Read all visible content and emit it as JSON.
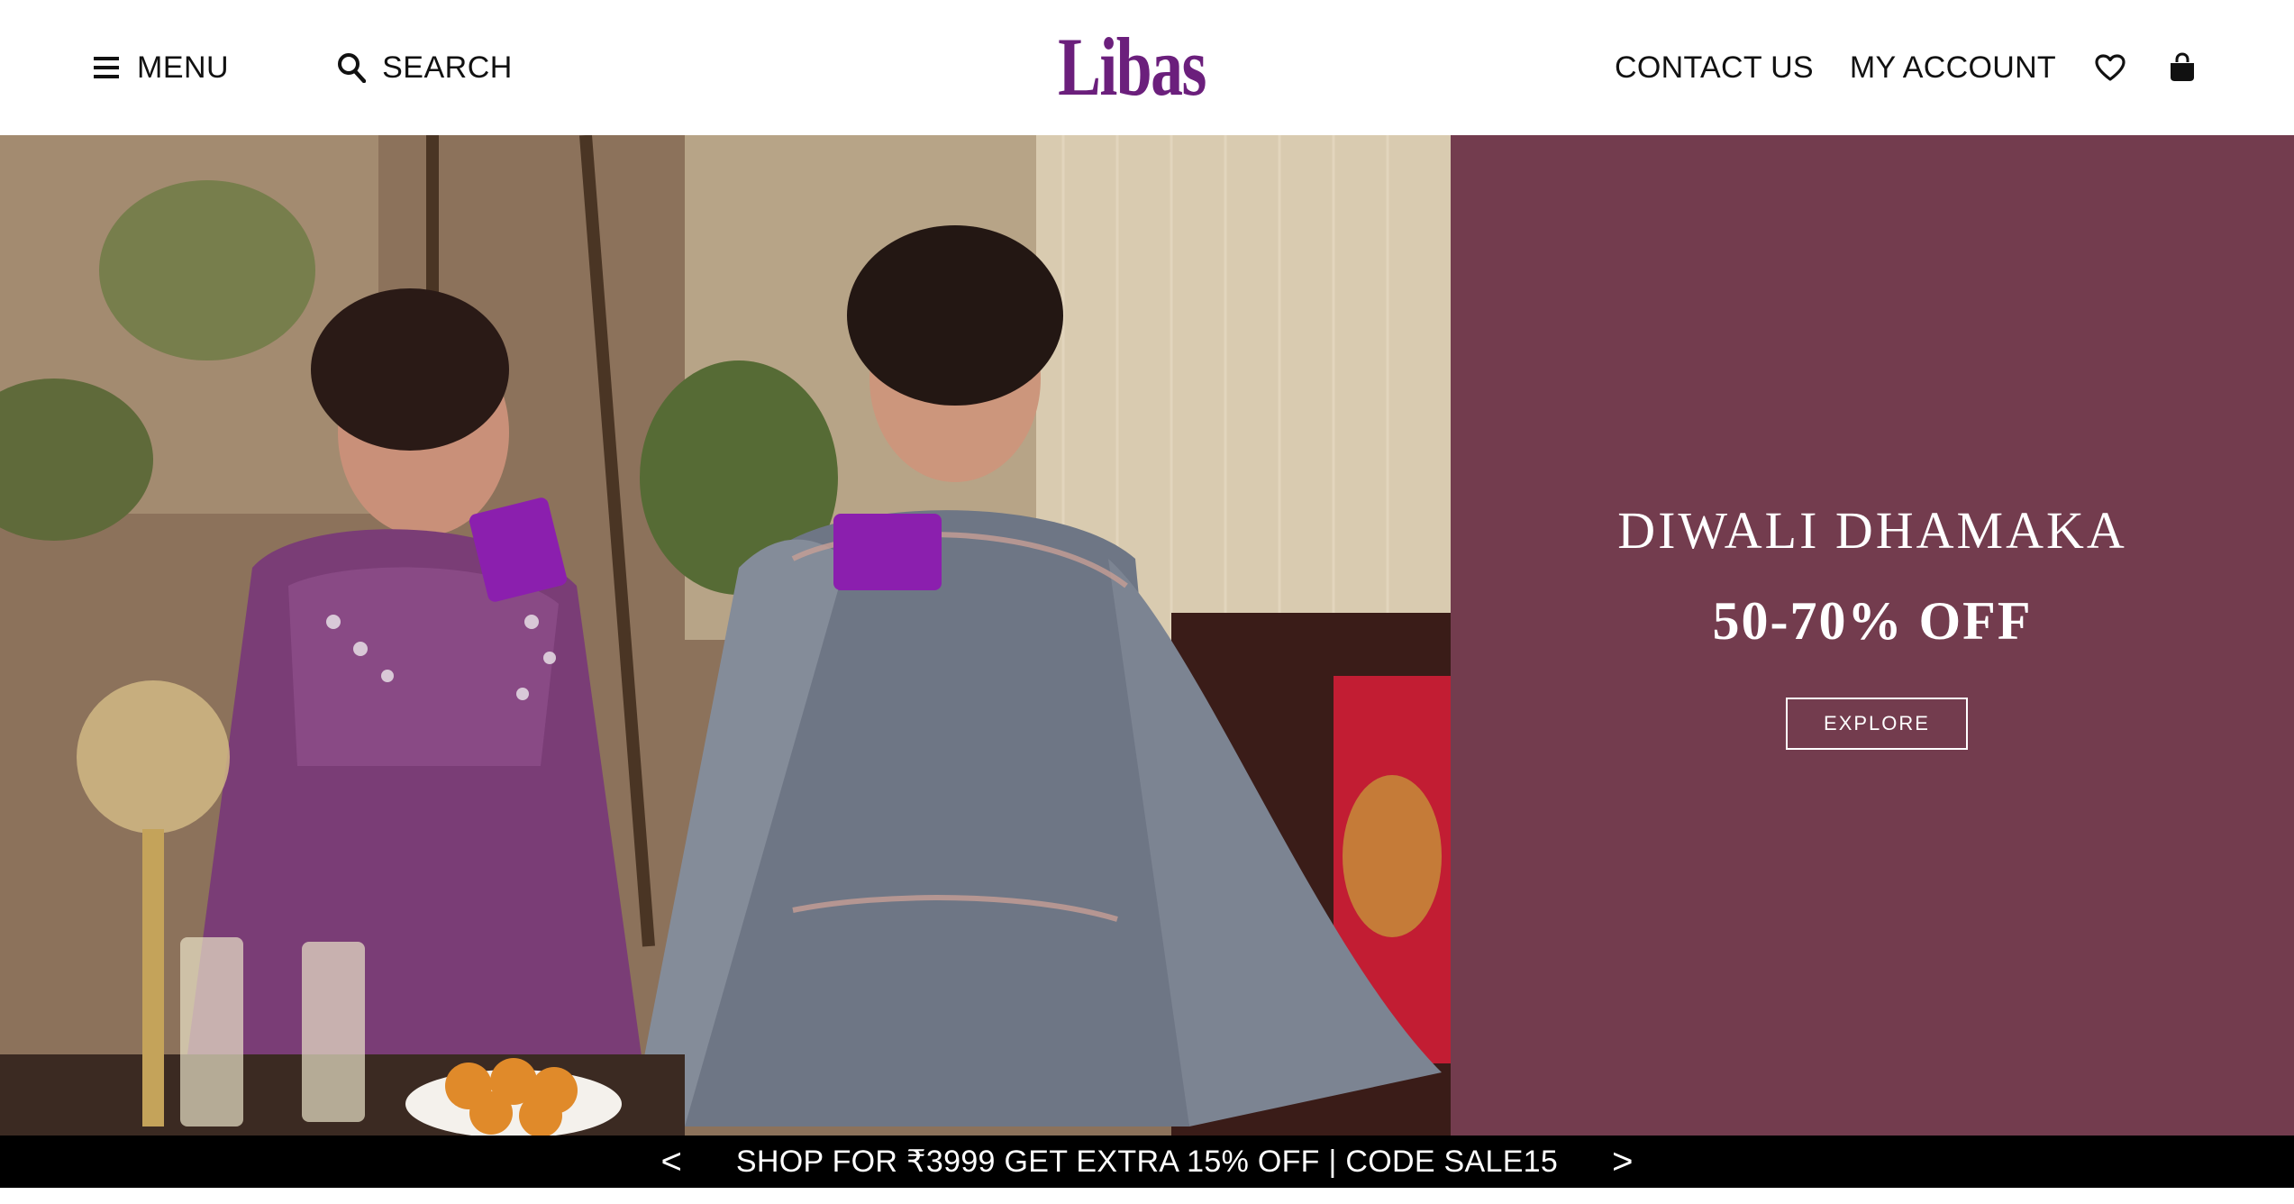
{
  "header": {
    "menu_label": "MENU",
    "search_label": "SEARCH",
    "logo_text": "Libas",
    "contact_label": "CONTACT US",
    "account_label": "MY ACCOUNT"
  },
  "hero": {
    "title": "DIWALI DHAMAKA",
    "subtitle": "50-70% OFF",
    "cta_label": "EXPLORE",
    "panel_color": "#733c4e"
  },
  "announcement": {
    "prev": "<",
    "text": "SHOP FOR ₹3999 GET EXTRA 15% OFF | CODE SALE15",
    "next": ">"
  },
  "colors": {
    "brand": "#6b1f7c",
    "bar": "#000000"
  },
  "icons": [
    "hamburger-menu-icon",
    "search-icon",
    "heart-icon",
    "shopping-bag-icon"
  ]
}
